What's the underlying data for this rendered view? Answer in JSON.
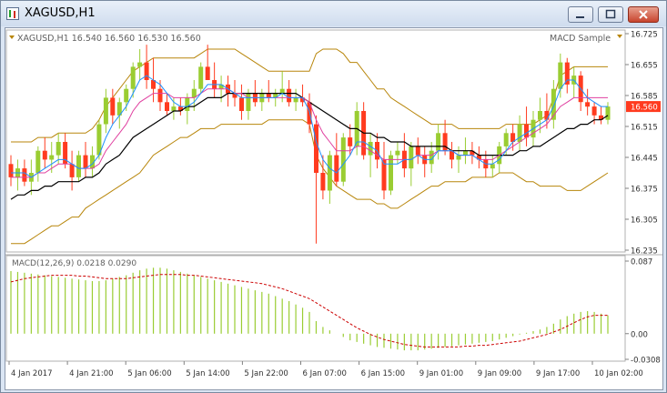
{
  "window": {
    "title": "XAGUSD,H1",
    "buttons": [
      "minimize",
      "maximize",
      "close"
    ]
  },
  "chart_header": {
    "symbol_info": "XAGUSD,H1  16.540 16.560 16.530 16.560",
    "indicator_label": "MACD Sample"
  },
  "colors": {
    "bull_candle": "#9acd32",
    "bear_candle": "#ff3b1f",
    "bollinger": "#b8860b",
    "ma_black": "#000000",
    "ma_blue": "#1e90ff",
    "ma_pink": "#e040a0",
    "macd_hist": "#9acd32",
    "macd_signal": "#cc0000",
    "price_marker_bg": "#ff3b1f"
  },
  "chart_data": [
    {
      "type": "candlestick",
      "price_axis_ticks": [
        "16.725",
        "16.655",
        "16.585",
        "16.515",
        "16.445",
        "16.375",
        "16.305",
        "16.235"
      ],
      "current_price": "16.560",
      "ylim": [
        16.235,
        16.725
      ],
      "time_labels": [
        "4 Jan 2017",
        "4 Jan 21:00",
        "5 Jan 06:00",
        "5 Jan 14:00",
        "5 Jan 22:00",
        "6 Jan 07:00",
        "6 Jan 15:00",
        "9 Jan 01:00",
        "9 Jan 09:00",
        "9 Jan 17:00",
        "10 Jan 02:00"
      ],
      "ohlc": [
        [
          16.43,
          16.45,
          16.38,
          16.4
        ],
        [
          16.4,
          16.44,
          16.37,
          16.42
        ],
        [
          16.42,
          16.44,
          16.38,
          16.39
        ],
        [
          16.39,
          16.44,
          16.36,
          16.41
        ],
        [
          16.41,
          16.47,
          16.39,
          16.46
        ],
        [
          16.46,
          16.49,
          16.42,
          16.44
        ],
        [
          16.44,
          16.48,
          16.41,
          16.45
        ],
        [
          16.45,
          16.5,
          16.43,
          16.48
        ],
        [
          16.48,
          16.5,
          16.42,
          16.43
        ],
        [
          16.43,
          16.46,
          16.37,
          16.4
        ],
        [
          16.4,
          16.46,
          16.39,
          16.45
        ],
        [
          16.45,
          16.48,
          16.4,
          16.42
        ],
        [
          16.42,
          16.47,
          16.4,
          16.45
        ],
        [
          16.45,
          16.53,
          16.44,
          16.52
        ],
        [
          16.52,
          16.6,
          16.5,
          16.58
        ],
        [
          16.58,
          16.6,
          16.52,
          16.54
        ],
        [
          16.54,
          16.58,
          16.51,
          16.57
        ],
        [
          16.57,
          16.61,
          16.55,
          16.6
        ],
        [
          16.6,
          16.66,
          16.58,
          16.65
        ],
        [
          16.65,
          16.69,
          16.62,
          16.66
        ],
        [
          16.66,
          16.7,
          16.6,
          16.62
        ],
        [
          16.62,
          16.67,
          16.57,
          16.6
        ],
        [
          16.6,
          16.62,
          16.55,
          16.57
        ],
        [
          16.57,
          16.59,
          16.54,
          16.55
        ],
        [
          16.55,
          16.58,
          16.53,
          16.56
        ],
        [
          16.56,
          16.58,
          16.54,
          16.55
        ],
        [
          16.55,
          16.59,
          16.52,
          16.58
        ],
        [
          16.58,
          16.62,
          16.55,
          16.6
        ],
        [
          16.6,
          16.66,
          16.59,
          16.65
        ],
        [
          16.65,
          16.7,
          16.62,
          16.62
        ],
        [
          16.62,
          16.66,
          16.58,
          16.6
        ],
        [
          16.6,
          16.63,
          16.57,
          16.61
        ],
        [
          16.61,
          16.63,
          16.56,
          16.59
        ],
        [
          16.59,
          16.62,
          16.56,
          16.58
        ],
        [
          16.58,
          16.61,
          16.53,
          16.55
        ],
        [
          16.55,
          16.6,
          16.53,
          16.59
        ],
        [
          16.59,
          16.62,
          16.56,
          16.57
        ],
        [
          16.57,
          16.6,
          16.55,
          16.59
        ],
        [
          16.59,
          16.62,
          16.57,
          16.58
        ],
        [
          16.58,
          16.6,
          16.56,
          16.59
        ],
        [
          16.59,
          16.64,
          16.57,
          16.6
        ],
        [
          16.6,
          16.62,
          16.56,
          16.57
        ],
        [
          16.57,
          16.6,
          16.55,
          16.58
        ],
        [
          16.58,
          16.61,
          16.56,
          16.57
        ],
        [
          16.57,
          16.59,
          16.5,
          16.52
        ],
        [
          16.52,
          16.54,
          16.25,
          16.41
        ],
        [
          16.41,
          16.45,
          16.35,
          16.37
        ],
        [
          16.37,
          16.46,
          16.34,
          16.45
        ],
        [
          16.45,
          16.5,
          16.38,
          16.39
        ],
        [
          16.39,
          16.5,
          16.38,
          16.49
        ],
        [
          16.49,
          16.52,
          16.45,
          16.47
        ],
        [
          16.47,
          16.57,
          16.45,
          16.55
        ],
        [
          16.55,
          16.57,
          16.44,
          16.45
        ],
        [
          16.45,
          16.5,
          16.4,
          16.48
        ],
        [
          16.48,
          16.5,
          16.42,
          16.44
        ],
        [
          16.44,
          16.48,
          16.35,
          16.37
        ],
        [
          16.37,
          16.46,
          16.36,
          16.45
        ],
        [
          16.45,
          16.48,
          16.43,
          16.46
        ],
        [
          16.46,
          16.5,
          16.4,
          16.42
        ],
        [
          16.42,
          16.48,
          16.38,
          16.47
        ],
        [
          16.47,
          16.49,
          16.43,
          16.45
        ],
        [
          16.45,
          16.47,
          16.4,
          16.43
        ],
        [
          16.43,
          16.48,
          16.41,
          16.46
        ],
        [
          16.46,
          16.52,
          16.44,
          16.5
        ],
        [
          16.5,
          16.53,
          16.45,
          16.46
        ],
        [
          16.46,
          16.48,
          16.42,
          16.44
        ],
        [
          16.44,
          16.47,
          16.41,
          16.45
        ],
        [
          16.45,
          16.49,
          16.43,
          16.46
        ],
        [
          16.46,
          16.48,
          16.43,
          16.45
        ],
        [
          16.45,
          16.47,
          16.42,
          16.44
        ],
        [
          16.44,
          16.46,
          16.4,
          16.42
        ],
        [
          16.42,
          16.45,
          16.4,
          16.43
        ],
        [
          16.43,
          16.48,
          16.41,
          16.47
        ],
        [
          16.47,
          16.51,
          16.45,
          16.5
        ],
        [
          16.5,
          16.52,
          16.46,
          16.48
        ],
        [
          16.48,
          16.54,
          16.46,
          16.52
        ],
        [
          16.52,
          16.56,
          16.47,
          16.49
        ],
        [
          16.49,
          16.55,
          16.47,
          16.53
        ],
        [
          16.53,
          16.58,
          16.5,
          16.55
        ],
        [
          16.55,
          16.59,
          16.51,
          16.53
        ],
        [
          16.53,
          16.62,
          16.51,
          16.6
        ],
        [
          16.6,
          16.68,
          16.58,
          16.66
        ],
        [
          16.66,
          16.67,
          16.59,
          16.61
        ],
        [
          16.61,
          16.65,
          16.58,
          16.63
        ],
        [
          16.63,
          16.64,
          16.55,
          16.57
        ],
        [
          16.57,
          16.6,
          16.54,
          16.56
        ],
        [
          16.56,
          16.57,
          16.52,
          16.54
        ],
        [
          16.54,
          16.56,
          16.52,
          16.53
        ],
        [
          16.53,
          16.57,
          16.52,
          16.56
        ]
      ],
      "bollinger": {
        "upper": [
          16.48,
          16.48,
          16.48,
          16.48,
          16.49,
          16.49,
          16.49,
          16.5,
          16.5,
          16.5,
          16.5,
          16.5,
          16.51,
          16.53,
          16.56,
          16.58,
          16.6,
          16.62,
          16.64,
          16.65,
          16.66,
          16.67,
          16.67,
          16.67,
          16.67,
          16.67,
          16.67,
          16.67,
          16.68,
          16.69,
          16.69,
          16.69,
          16.69,
          16.69,
          16.68,
          16.67,
          16.66,
          16.65,
          16.64,
          16.64,
          16.64,
          16.64,
          16.64,
          16.64,
          16.64,
          16.68,
          16.69,
          16.69,
          16.69,
          16.68,
          16.66,
          16.66,
          16.64,
          16.62,
          16.6,
          16.6,
          16.58,
          16.57,
          16.56,
          16.55,
          16.54,
          16.53,
          16.52,
          16.52,
          16.52,
          16.52,
          16.51,
          16.51,
          16.51,
          16.51,
          16.51,
          16.51,
          16.51,
          16.52,
          16.52,
          16.52,
          16.52,
          16.52,
          16.53,
          16.54,
          16.58,
          16.63,
          16.64,
          16.65,
          16.65,
          16.65,
          16.65,
          16.65,
          16.65
        ],
        "lower": [
          16.25,
          16.25,
          16.25,
          16.26,
          16.27,
          16.28,
          16.29,
          16.29,
          16.3,
          16.31,
          16.31,
          16.33,
          16.34,
          16.35,
          16.36,
          16.37,
          16.38,
          16.39,
          16.4,
          16.41,
          16.43,
          16.45,
          16.46,
          16.47,
          16.48,
          16.49,
          16.49,
          16.5,
          16.51,
          16.51,
          16.51,
          16.52,
          16.52,
          16.52,
          16.52,
          16.52,
          16.52,
          16.52,
          16.53,
          16.53,
          16.53,
          16.53,
          16.53,
          16.53,
          16.52,
          16.45,
          16.42,
          16.4,
          16.38,
          16.37,
          16.36,
          16.35,
          16.35,
          16.35,
          16.34,
          16.34,
          16.33,
          16.33,
          16.34,
          16.35,
          16.36,
          16.37,
          16.38,
          16.38,
          16.39,
          16.39,
          16.39,
          16.39,
          16.4,
          16.4,
          16.4,
          16.4,
          16.41,
          16.41,
          16.41,
          16.4,
          16.39,
          16.39,
          16.38,
          16.38,
          16.38,
          16.38,
          16.37,
          16.37,
          16.37,
          16.38,
          16.39,
          16.4,
          16.41
        ]
      },
      "ma_black": [
        16.35,
        16.36,
        16.36,
        16.37,
        16.37,
        16.38,
        16.38,
        16.39,
        16.39,
        16.39,
        16.39,
        16.4,
        16.4,
        16.41,
        16.43,
        16.44,
        16.45,
        16.47,
        16.49,
        16.5,
        16.51,
        16.52,
        16.53,
        16.54,
        16.55,
        16.55,
        16.56,
        16.56,
        16.57,
        16.58,
        16.58,
        16.58,
        16.59,
        16.59,
        16.59,
        16.59,
        16.59,
        16.59,
        16.59,
        16.59,
        16.59,
        16.59,
        16.59,
        16.58,
        16.57,
        16.56,
        16.55,
        16.54,
        16.53,
        16.52,
        16.51,
        16.51,
        16.5,
        16.5,
        16.49,
        16.49,
        16.48,
        16.48,
        16.48,
        16.47,
        16.47,
        16.47,
        16.47,
        16.47,
        16.47,
        16.46,
        16.46,
        16.46,
        16.46,
        16.45,
        16.45,
        16.45,
        16.45,
        16.45,
        16.45,
        16.46,
        16.46,
        16.47,
        16.47,
        16.48,
        16.49,
        16.5,
        16.51,
        16.51,
        16.52,
        16.52,
        16.53,
        16.53,
        16.54
      ],
      "ma_pink": [
        16.4,
        16.4,
        16.4,
        16.4,
        16.41,
        16.41,
        16.42,
        16.43,
        16.43,
        16.43,
        16.42,
        16.42,
        16.42,
        16.43,
        16.46,
        16.48,
        16.5,
        16.52,
        16.55,
        16.57,
        16.58,
        16.59,
        16.59,
        16.59,
        16.58,
        16.58,
        16.58,
        16.58,
        16.59,
        16.6,
        16.6,
        16.6,
        16.6,
        16.59,
        16.59,
        16.58,
        16.58,
        16.58,
        16.58,
        16.58,
        16.58,
        16.58,
        16.58,
        16.58,
        16.57,
        16.53,
        16.5,
        16.48,
        16.46,
        16.46,
        16.46,
        16.47,
        16.47,
        16.46,
        16.45,
        16.44,
        16.44,
        16.44,
        16.44,
        16.44,
        16.45,
        16.45,
        16.45,
        16.46,
        16.46,
        16.46,
        16.45,
        16.45,
        16.45,
        16.44,
        16.44,
        16.44,
        16.45,
        16.46,
        16.47,
        16.48,
        16.49,
        16.5,
        16.51,
        16.52,
        16.54,
        16.56,
        16.57,
        16.58,
        16.58,
        16.58,
        16.58,
        16.58,
        16.58
      ],
      "ma_blue": [
        16.41,
        16.41,
        16.41,
        16.4,
        16.41,
        16.42,
        16.43,
        16.44,
        16.44,
        16.43,
        16.42,
        16.42,
        16.43,
        16.45,
        16.49,
        16.52,
        16.54,
        16.56,
        16.59,
        16.62,
        16.63,
        16.62,
        16.61,
        16.59,
        16.57,
        16.56,
        16.56,
        16.57,
        16.59,
        16.61,
        16.61,
        16.61,
        16.6,
        16.59,
        16.58,
        16.58,
        16.58,
        16.58,
        16.58,
        16.58,
        16.59,
        16.58,
        16.58,
        16.58,
        16.55,
        16.48,
        16.44,
        16.42,
        16.41,
        16.43,
        16.45,
        16.48,
        16.48,
        16.47,
        16.46,
        16.43,
        16.43,
        16.43,
        16.44,
        16.44,
        16.45,
        16.44,
        16.44,
        16.46,
        16.46,
        16.46,
        16.45,
        16.45,
        16.45,
        16.44,
        16.43,
        16.43,
        16.44,
        16.46,
        16.48,
        16.49,
        16.5,
        16.51,
        16.52,
        16.53,
        16.56,
        16.6,
        16.62,
        16.62,
        16.6,
        16.58,
        16.57,
        16.56,
        16.56
      ]
    },
    {
      "type": "bar",
      "label": "MACD(12,26,9) 0.0218 0.0290",
      "axis_ticks": [
        "0.087",
        "0.00",
        "-0.0308"
      ],
      "ylim": [
        -0.0308,
        0.087
      ],
      "histogram": [
        0.075,
        0.074,
        0.073,
        0.072,
        0.071,
        0.07,
        0.069,
        0.068,
        0.067,
        0.066,
        0.065,
        0.064,
        0.063,
        0.063,
        0.064,
        0.066,
        0.068,
        0.07,
        0.073,
        0.076,
        0.078,
        0.079,
        0.079,
        0.078,
        0.076,
        0.074,
        0.072,
        0.07,
        0.068,
        0.066,
        0.064,
        0.062,
        0.06,
        0.058,
        0.056,
        0.054,
        0.052,
        0.05,
        0.048,
        0.045,
        0.042,
        0.039,
        0.035,
        0.031,
        0.026,
        0.015,
        0.008,
        0.004,
        0.0,
        -0.004,
        -0.008,
        -0.01,
        -0.012,
        -0.014,
        -0.016,
        -0.017,
        -0.018,
        -0.019,
        -0.02,
        -0.02,
        -0.02,
        -0.019,
        -0.018,
        -0.017,
        -0.016,
        -0.015,
        -0.014,
        -0.013,
        -0.012,
        -0.011,
        -0.01,
        -0.009,
        -0.007,
        -0.005,
        -0.003,
        -0.001,
        0.001,
        0.003,
        0.005,
        0.008,
        0.012,
        0.017,
        0.021,
        0.024,
        0.026,
        0.027,
        0.026,
        0.024,
        0.022
      ],
      "signal": [
        0.062,
        0.064,
        0.066,
        0.067,
        0.068,
        0.069,
        0.07,
        0.07,
        0.07,
        0.07,
        0.069,
        0.069,
        0.068,
        0.067,
        0.066,
        0.066,
        0.066,
        0.066,
        0.067,
        0.068,
        0.069,
        0.07,
        0.071,
        0.071,
        0.071,
        0.071,
        0.07,
        0.07,
        0.069,
        0.068,
        0.067,
        0.066,
        0.065,
        0.064,
        0.063,
        0.062,
        0.061,
        0.06,
        0.058,
        0.056,
        0.054,
        0.051,
        0.048,
        0.045,
        0.042,
        0.037,
        0.032,
        0.027,
        0.022,
        0.017,
        0.012,
        0.007,
        0.003,
        -0.001,
        -0.004,
        -0.007,
        -0.009,
        -0.011,
        -0.013,
        -0.014,
        -0.015,
        -0.016,
        -0.016,
        -0.016,
        -0.016,
        -0.016,
        -0.016,
        -0.015,
        -0.015,
        -0.014,
        -0.014,
        -0.013,
        -0.012,
        -0.011,
        -0.01,
        -0.009,
        -0.007,
        -0.005,
        -0.003,
        -0.001,
        0.002,
        0.005,
        0.009,
        0.013,
        0.017,
        0.02,
        0.022,
        0.022,
        0.022
      ]
    }
  ]
}
